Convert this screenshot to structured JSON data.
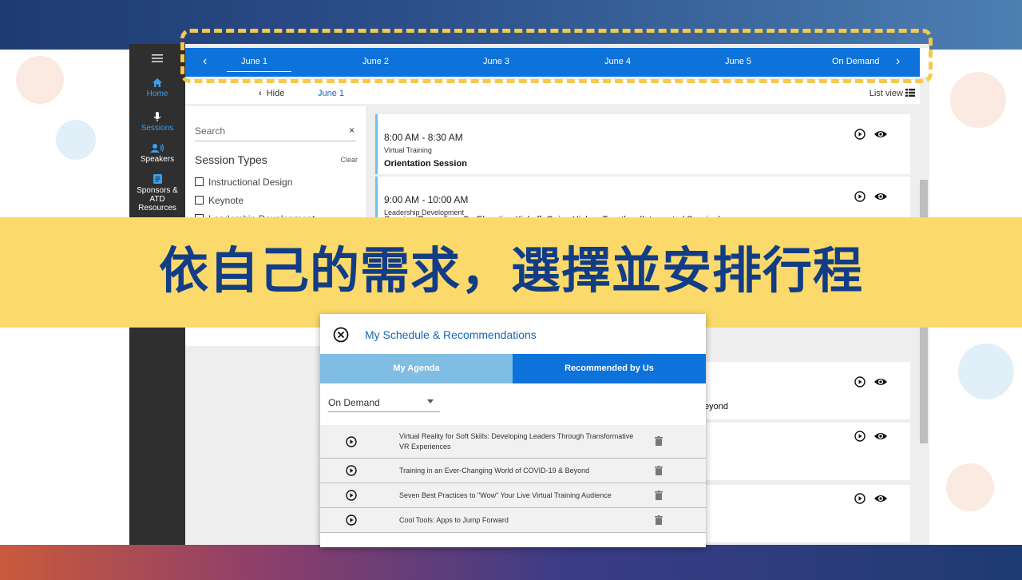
{
  "nav": {
    "home": "Home",
    "sessions": "Sessions",
    "speakers": "Speakers",
    "sponsors_line1": "Sponsors &",
    "sponsors_line2": "ATD",
    "sponsors_line3": "Resources"
  },
  "tabs": [
    "June 1",
    "June 2",
    "June 3",
    "June 4",
    "June 5",
    "On Demand"
  ],
  "subheader": {
    "hide_label": "Hide",
    "current_date": "June 1",
    "list_view_label": "List view"
  },
  "filters": {
    "search_placeholder": "Search",
    "clear_search": "×",
    "heading": "Session Types",
    "clear_label": "Clear",
    "options": [
      "Instructional Design",
      "Keynote",
      "Leadership Development"
    ]
  },
  "sessions": [
    {
      "time": "8:00 AM - 8:30 AM",
      "category": "Virtual Training",
      "title": "Orientation Session"
    },
    {
      "time": "9:00 AM - 10:00 AM",
      "category": "Leadership Development",
      "title": "Session Recording: Co-Elevation Kickoff: Going Higher, Together (Interpreted Session)"
    },
    {
      "time": "",
      "category": "",
      "title": "eyond"
    }
  ],
  "banner": {
    "text": "依自己的需求，選擇並安排行程"
  },
  "modal": {
    "title": "My Schedule & Recommendations",
    "tab_agenda": "My Agenda",
    "tab_recommended": "Recommended by Us",
    "dropdown_value": "On Demand",
    "items": [
      {
        "line1": "Virtual Reality for Soft Skills: Developing Leaders Through Transformative",
        "line2": "VR Experiences"
      },
      {
        "line1": "Training in an Ever-Changing World of COVID-19 & Beyond",
        "line2": ""
      },
      {
        "line1": "Seven Best Practices to \"Wow\" Your Live Virtual Training Audience",
        "line2": ""
      },
      {
        "line1": "Cool Tools: Apps to Jump Forward",
        "line2": ""
      }
    ]
  },
  "colors": {
    "tab_blue": "#0d72d9",
    "banner_yellow": "#fbd96b",
    "banner_text": "#123d86",
    "dash_yellow": "#f6c84e",
    "tab_light_blue": "#7fbde3"
  }
}
